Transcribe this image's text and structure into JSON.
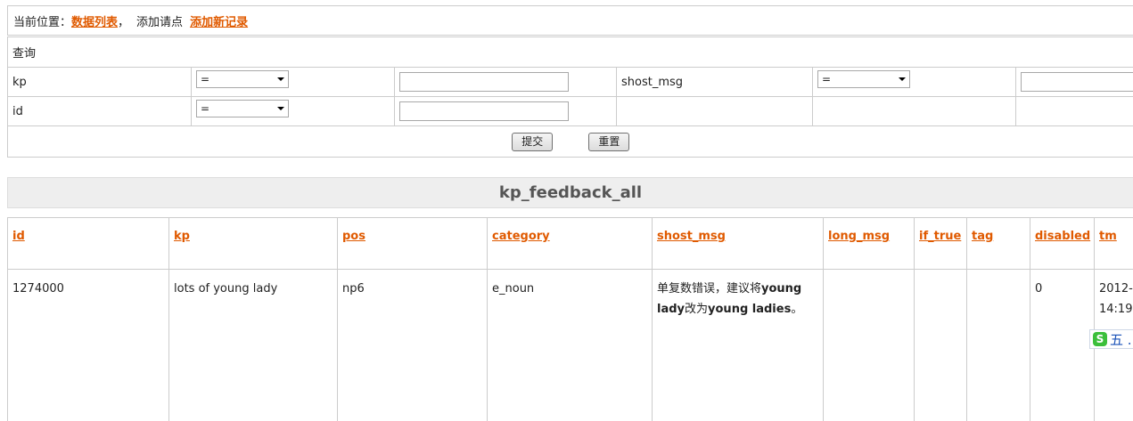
{
  "breadcrumb": {
    "prefix": "当前位置：",
    "list_link": "数据列表",
    "separator": "，",
    "hint": "添加请点",
    "add_link": "添加新记录"
  },
  "query": {
    "title": "查询",
    "rows": [
      {
        "field1": "kp",
        "op1": "=",
        "value1": "",
        "field2": "shost_msg",
        "op2": "=",
        "value2": ""
      },
      {
        "field1": "id",
        "op1": "=",
        "value1": ""
      }
    ],
    "submit_label": "提交",
    "reset_label": "重置"
  },
  "table": {
    "title": "kp_feedback_all",
    "columns": [
      "id",
      "kp",
      "pos",
      "category",
      "shost_msg",
      "long_msg",
      "if_true",
      "tag",
      "disabled",
      "tm"
    ],
    "rows": [
      {
        "id": "1274000",
        "kp": "lots of young lady",
        "pos": "np6",
        "category": "e_noun",
        "shost_msg": {
          "p1": "单复数错误，建议将",
          "b1": "young lady",
          "p2": "改为",
          "b2": "young ladies",
          "p3": "。"
        },
        "long_msg": "",
        "if_true": "",
        "tag": "",
        "disabled": "0",
        "tm": {
          "line1": "2012-",
          "line2": "14:19"
        }
      }
    ]
  },
  "ime": {
    "icon": "sogou-s-icon",
    "logo_glyph": "S",
    "text": "五 ."
  }
}
